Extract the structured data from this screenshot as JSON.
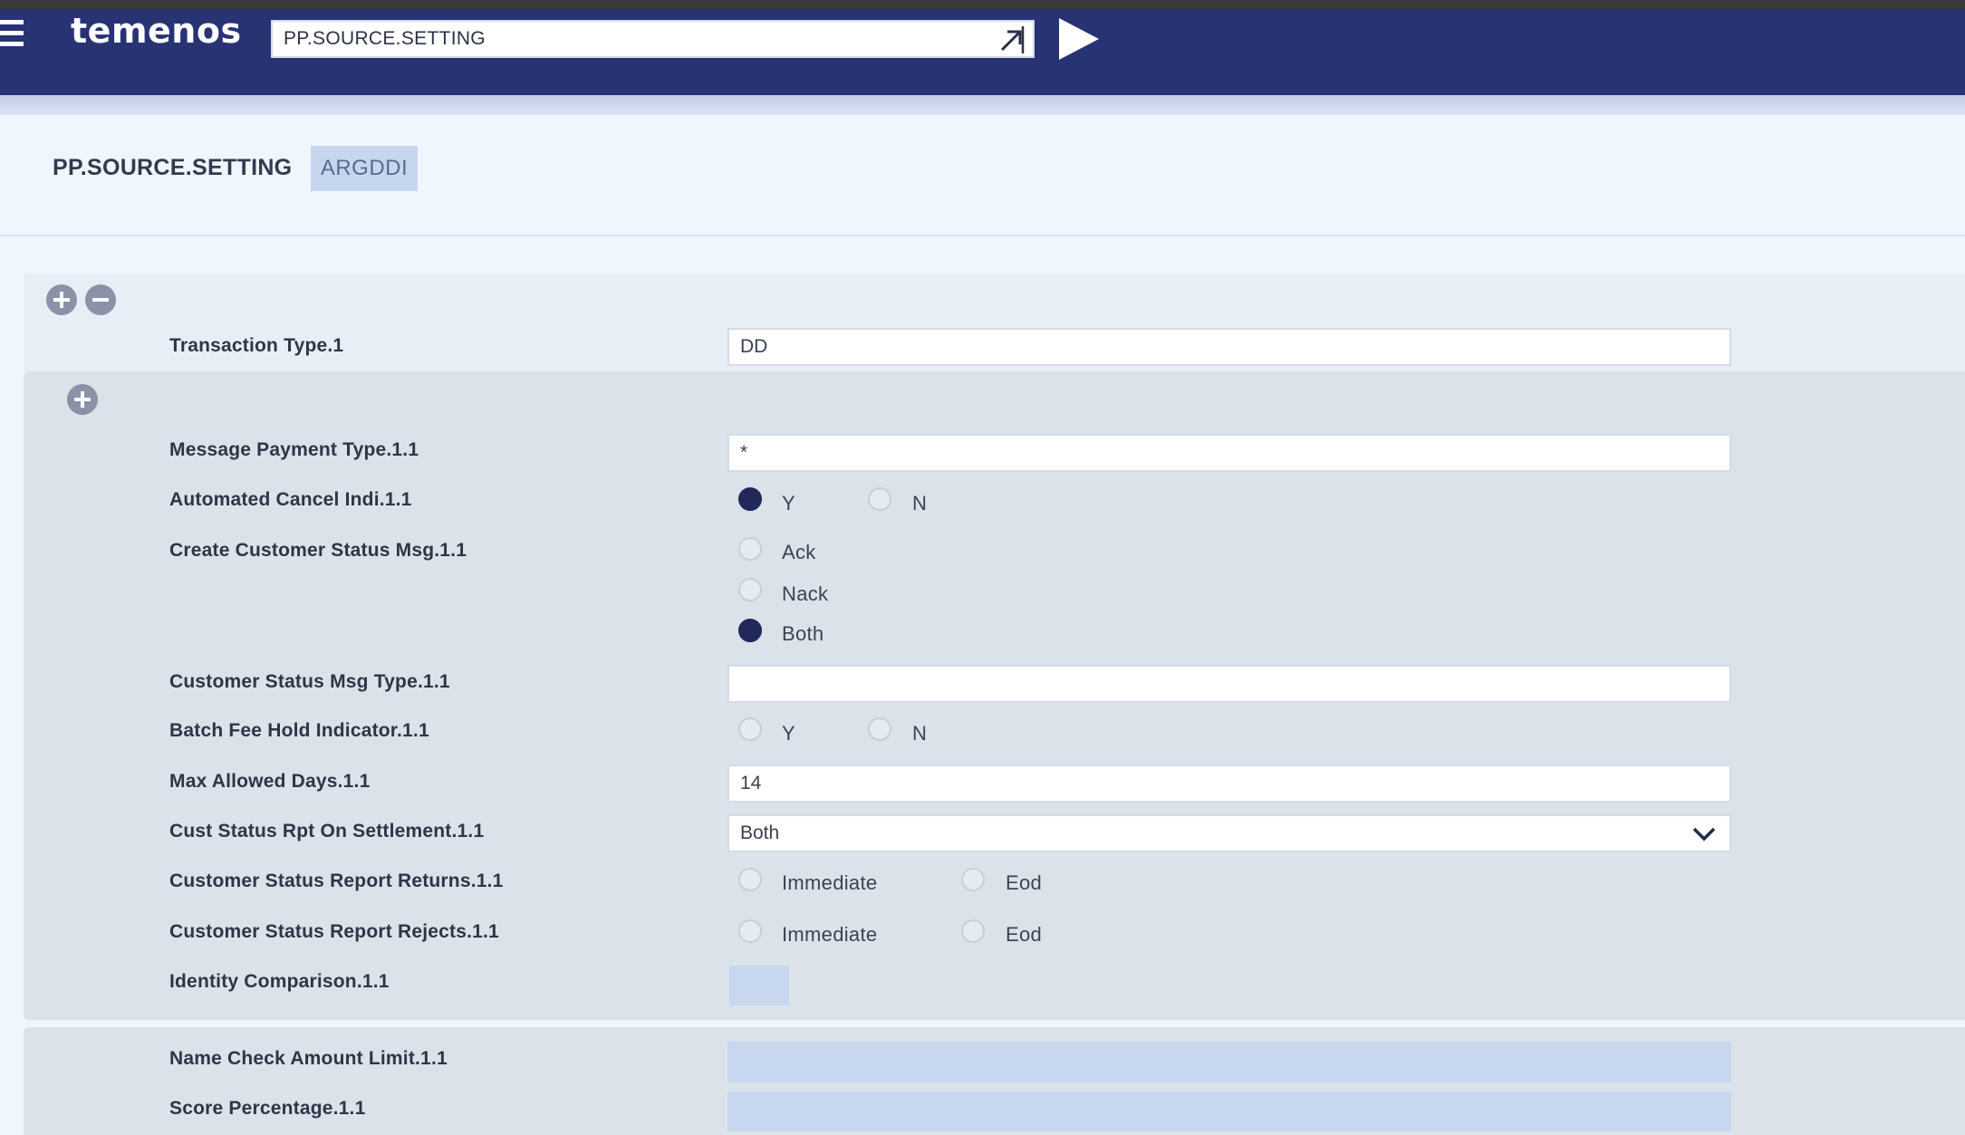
{
  "header": {
    "logo": "temenos",
    "command_value": "PP.SOURCE.SETTING"
  },
  "title": {
    "app_name": "PP.SOURCE.SETTING",
    "record_id": "ARGDDI"
  },
  "fields": {
    "transaction_type": {
      "label": "Transaction Type.1",
      "value": "DD"
    },
    "message_payment_type": {
      "label": "Message Payment Type.1.1",
      "value": "*"
    },
    "automated_cancel_indi": {
      "label": "Automated Cancel Indi.1.1",
      "options": [
        "Y",
        "N"
      ],
      "selected": "Y"
    },
    "create_customer_status_msg": {
      "label": "Create Customer Status Msg.1.1",
      "options": [
        "Ack",
        "Nack",
        "Both"
      ],
      "selected": "Both"
    },
    "customer_status_msg_type": {
      "label": "Customer Status Msg Type.1.1",
      "value": ""
    },
    "batch_fee_hold_indicator": {
      "label": "Batch Fee Hold Indicator.1.1",
      "options": [
        "Y",
        "N"
      ],
      "selected": ""
    },
    "max_allowed_days": {
      "label": "Max Allowed Days.1.1",
      "value": "14"
    },
    "cust_status_rpt_on_settlement": {
      "label": "Cust Status Rpt On Settlement.1.1",
      "value": "Both"
    },
    "customer_status_report_returns": {
      "label": "Customer Status Report Returns.1.1",
      "options": [
        "Immediate",
        "Eod"
      ],
      "selected": ""
    },
    "customer_status_report_rejects": {
      "label": "Customer Status Report Rejects.1.1",
      "options": [
        "Immediate",
        "Eod"
      ],
      "selected": ""
    },
    "identity_comparison": {
      "label": "Identity Comparison.1.1",
      "value": ""
    },
    "name_check_amount_limit": {
      "label": "Name Check Amount Limit.1.1",
      "value": ""
    },
    "score_percentage": {
      "label": "Score Percentage.1.1",
      "value": ""
    }
  },
  "icons": {
    "menu": "hamburger-icon",
    "expand": "expand-arrow-icon",
    "run": "play-icon",
    "add": "plus-circle-icon",
    "remove": "minus-circle-icon",
    "dropdown": "chevron-down-icon"
  },
  "colors": {
    "header_bg": "#283374",
    "selected_radio": "#21285a",
    "highlight_field": "#c8d7f0"
  }
}
